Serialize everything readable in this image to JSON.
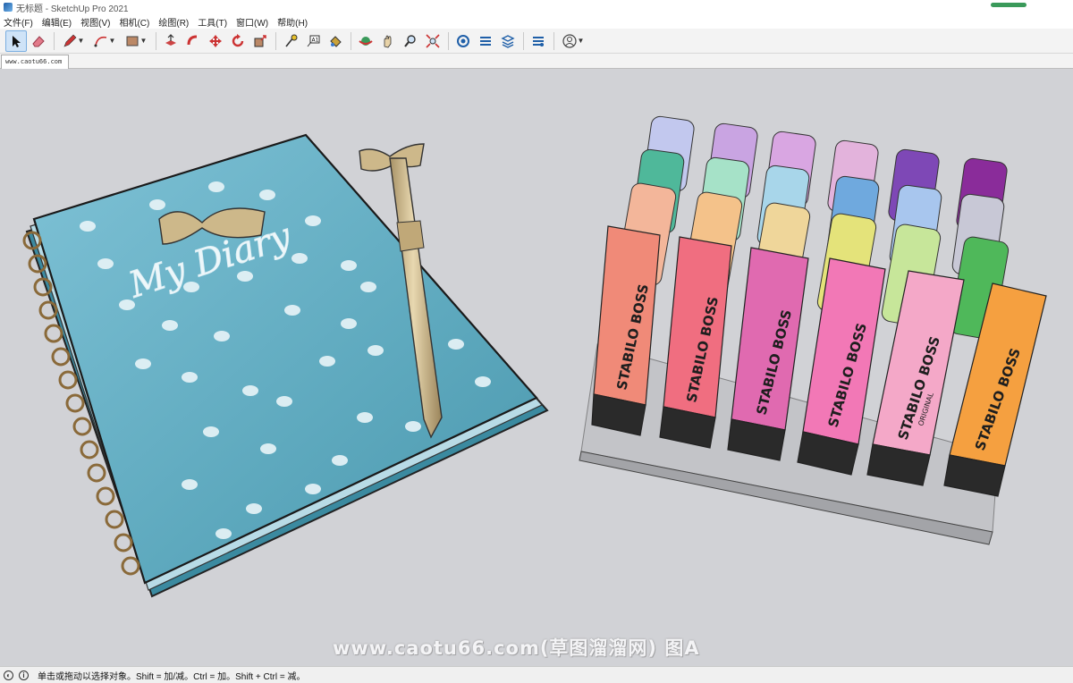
{
  "window": {
    "title": "无标题 - SketchUp Pro 2021"
  },
  "menu": [
    "文件(F)",
    "编辑(E)",
    "视图(V)",
    "相机(C)",
    "绘图(R)",
    "工具(T)",
    "窗口(W)",
    "帮助(H)"
  ],
  "toolbar": {
    "tools": [
      "select-icon",
      "eraser-icon",
      "pencil-icon",
      "arc-icon",
      "rectangle-icon",
      "push-pull-icon",
      "follow-me-icon",
      "move-icon",
      "rotate-icon",
      "scale-icon",
      "tape-measure-icon",
      "text-icon",
      "paint-bucket-icon",
      "orbit-icon",
      "pan-icon",
      "zoom-icon",
      "zoom-extents-icon",
      "warehouse-icon",
      "extension-warehouse-icon",
      "layout-icon",
      "extension-manager-icon",
      "account-icon"
    ]
  },
  "scene_tab": {
    "label": "www.caotu66.com"
  },
  "viewport": {
    "notebook_title": "My Diary",
    "marker_brand": "STABILO BOSS",
    "marker_sub": "ORIGINAL",
    "watermark": "www.caotu66.com(草图溜溜网) 图A"
  },
  "status": {
    "text": "单击或拖动以选择对象。Shift = 加/减。Ctrl = 加。Shift + Ctrl = 减。"
  },
  "colors": {
    "notebook": "#6fb4c8",
    "pen": "#cdb88a",
    "viewport_bg": "#d1d2d6"
  }
}
